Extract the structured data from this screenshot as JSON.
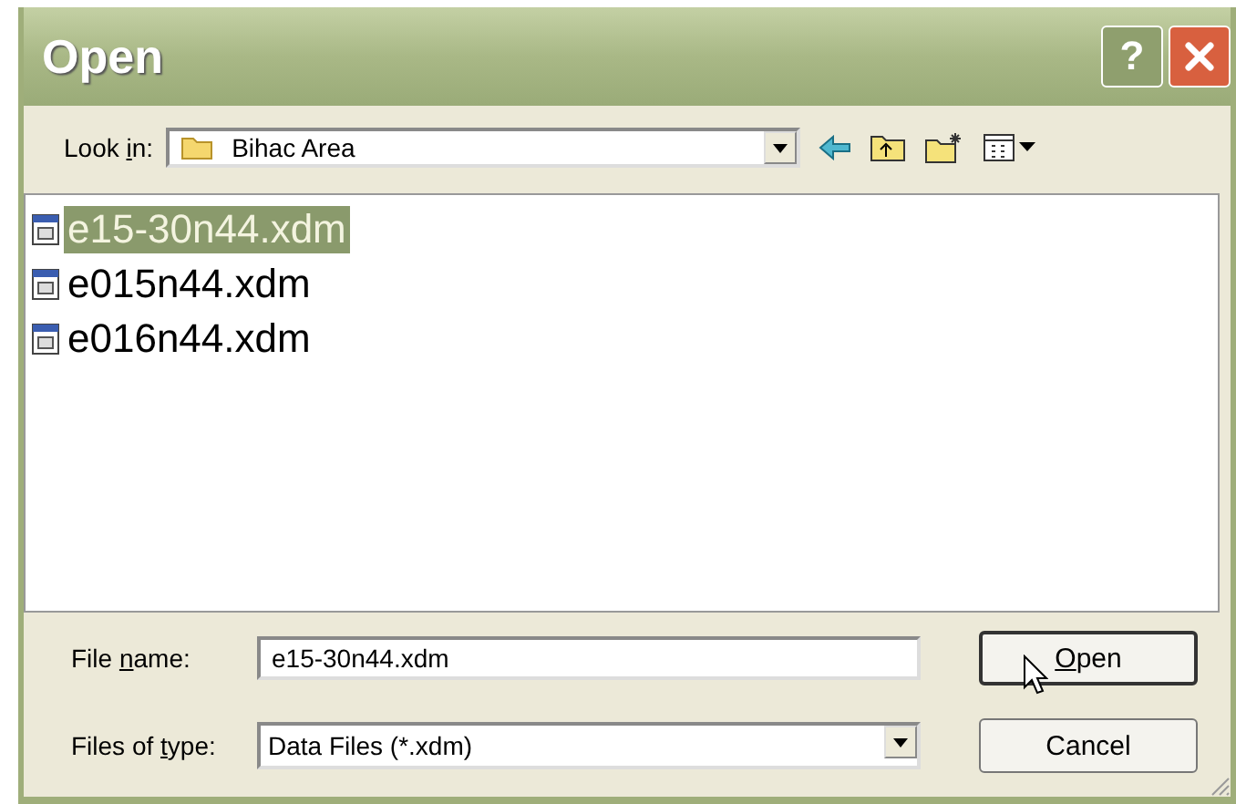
{
  "window": {
    "title": "Open",
    "title_buttons": [
      {
        "kind": "help",
        "label": "?"
      },
      {
        "kind": "close"
      }
    ]
  },
  "look_in": {
    "label_parts": [
      "Look ",
      "i",
      "n:"
    ],
    "value": "Bihac Area"
  },
  "files": [
    {
      "name": "e15-30n44.xdm",
      "selected": true
    },
    {
      "name": "e015n44.xdm",
      "selected": false
    },
    {
      "name": "e016n44.xdm",
      "selected": false
    }
  ],
  "file_name": {
    "label_parts": [
      "File ",
      "n",
      "ame:"
    ],
    "value": "e15-30n44.xdm"
  },
  "file_type": {
    "label_parts": [
      "Files of ",
      "t",
      "ype:"
    ],
    "value": "Data Files (*.xdm)"
  },
  "buttons": [
    {
      "label": "Open",
      "underline_first": true,
      "kind": "default"
    },
    {
      "label": "Cancel",
      "underline_first": false,
      "kind": "normal"
    }
  ]
}
